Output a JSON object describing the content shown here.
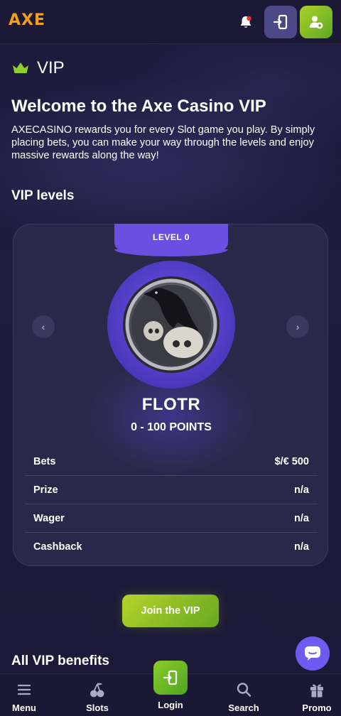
{
  "header": {
    "logo_text": "AXE",
    "icons": [
      "bell-icon",
      "login-icon",
      "add-user-icon"
    ]
  },
  "vip": {
    "title": "VIP",
    "welcome_title": "Welcome to the Axe Casino VIP",
    "intro": "AXECASINO rewards you for every Slot game you play. By simply placing bets, you can make your way through the levels and enjoy massive rewards along the way!"
  },
  "levels": {
    "heading": "VIP levels",
    "current": {
      "tab_label": "LEVEL 0",
      "name": "FLOTR",
      "points": "0 - 100 POINTS",
      "stats": [
        {
          "label": "Bets",
          "value": "$/€ 500"
        },
        {
          "label": "Prize",
          "value": "n/a"
        },
        {
          "label": "Wager",
          "value": "n/a"
        },
        {
          "label": "Cashback",
          "value": "n/a"
        }
      ]
    }
  },
  "join_button": "Join the VIP",
  "benefits_heading": "All VIP benefits",
  "bottom_nav": [
    {
      "label": "Menu",
      "icon": "menu-icon"
    },
    {
      "label": "Slots",
      "icon": "cherries-icon"
    },
    {
      "label": "Login",
      "icon": "login-icon"
    },
    {
      "label": "Search",
      "icon": "search-icon"
    },
    {
      "label": "Promo",
      "icon": "gift-icon"
    }
  ],
  "colors": {
    "background": "#1e1b3a",
    "accent_purple": "#6a4fe0",
    "accent_green": "#8ccc2a",
    "logo_orange": "#f6a019"
  }
}
